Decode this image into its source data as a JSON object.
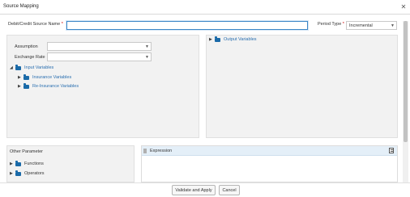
{
  "window": {
    "title": "Source Mapping"
  },
  "form": {
    "source_name_label": "Debit/Credit Source Name",
    "required_mark": "*",
    "source_name_value": "",
    "period_type_label": "Period Type",
    "period_type_value": "Incremental"
  },
  "left_panel": {
    "assumption_label": "Assumption",
    "assumption_value": "",
    "exchange_rate_label": "Exchange Rate",
    "exchange_rate_value": "",
    "tree": {
      "root": "Input Variables",
      "children": [
        "Insurance Variables",
        "Re-Insurance Variables"
      ]
    }
  },
  "right_panel": {
    "tree_root": "Output Variables"
  },
  "other_parameter": {
    "title": "Other Parameter",
    "items": [
      "Functions",
      "Operators"
    ]
  },
  "expression": {
    "title": "Expression"
  },
  "footer": {
    "validate_label": "Validate and Apply",
    "cancel_label": "Cancel"
  },
  "colors": {
    "accent": "#2a6fb0",
    "folder": "#1a6aa8",
    "panel_bg": "#f2f2f2",
    "expression_header": "#e4eff8"
  },
  "icons": [
    "close-icon",
    "chevron-down-icon",
    "triangle-right-icon",
    "triangle-down-icon",
    "folder-icon",
    "document-icon"
  ]
}
